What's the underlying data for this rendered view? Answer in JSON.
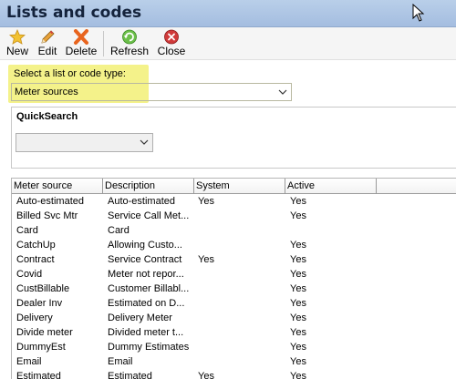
{
  "window": {
    "title": "Lists and codes"
  },
  "toolbar": {
    "buttons": [
      {
        "label": "New",
        "icon": "star-icon"
      },
      {
        "label": "Edit",
        "icon": "pencil-icon"
      },
      {
        "label": "Delete",
        "icon": "delete-x-icon"
      },
      {
        "label": "Refresh",
        "icon": "refresh-icon"
      },
      {
        "label": "Close",
        "icon": "close-icon"
      }
    ]
  },
  "type_selector": {
    "label": "Select a list or code type:",
    "value": "Meter sources",
    "highlight_color": "#f4f28a"
  },
  "quicksearch": {
    "title": "QuickSearch",
    "value": ""
  },
  "grid": {
    "columns": [
      "Meter source",
      "Description",
      "System",
      "Active"
    ],
    "rows": [
      {
        "source": "Auto-estimated",
        "description": "Auto-estimated",
        "system": "Yes",
        "active": "Yes"
      },
      {
        "source": "Billed Svc Mtr",
        "description": "Service Call Met...",
        "system": "",
        "active": "Yes"
      },
      {
        "source": "Card",
        "description": "Card",
        "system": "",
        "active": ""
      },
      {
        "source": "CatchUp",
        "description": "Allowing Custo...",
        "system": "",
        "active": "Yes"
      },
      {
        "source": "Contract",
        "description": "Service Contract",
        "system": "Yes",
        "active": "Yes"
      },
      {
        "source": "Covid",
        "description": "Meter not repor...",
        "system": "",
        "active": "Yes"
      },
      {
        "source": "CustBillable",
        "description": "Customer Billabl...",
        "system": "",
        "active": "Yes"
      },
      {
        "source": "Dealer Inv",
        "description": "Estimated on D...",
        "system": "",
        "active": "Yes"
      },
      {
        "source": "Delivery",
        "description": "Delivery Meter",
        "system": "",
        "active": "Yes"
      },
      {
        "source": "Divide meter",
        "description": "Divided meter t...",
        "system": "",
        "active": "Yes"
      },
      {
        "source": "DummyEst",
        "description": "Dummy Estimates",
        "system": "",
        "active": "Yes"
      },
      {
        "source": "Email",
        "description": "Email",
        "system": "",
        "active": "Yes"
      },
      {
        "source": "Estimated",
        "description": "Estimated",
        "system": "Yes",
        "active": "Yes"
      }
    ]
  }
}
